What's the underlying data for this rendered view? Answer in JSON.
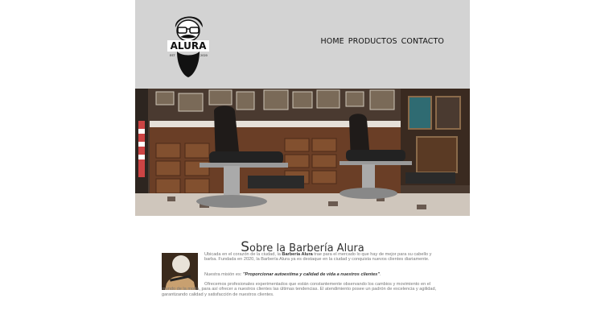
{
  "header": {
    "logo_text": "ALURA",
    "logo_est": "EST",
    "logo_year": "2020",
    "nav": [
      "HOME",
      "PRODUCTOS",
      "CONTACTO"
    ]
  },
  "about": {
    "title_first": "S",
    "title_rest": "obre la Barbería Alura",
    "p1_a": "Ubicada en el corazón de la ciudad, la ",
    "p1_brand": "Barbería Alura",
    "p1_b": " trae para el mercado lo que hay de mejor para su cabello y barba. Fundada en 2020, la Barbería Alura ya es destaque en la ciudad y conquista nuevos clientes diariamente.",
    "p2_a": "Nuestra misión es: ",
    "p2_quote": "\"Proporcionar autoestima y calidad de vida a nuestros clientes\"",
    "p2_b": ".",
    "p3": "Ofrecemos profesionales experimentados que están constantemente observando los cambios y movimiento en el mundo de la moda, para así ofrecer a nuestros clientes las últimas tendencias. El atendimiento posee un padrón de excelencia y agilidad, garantizando calidad y satisfacción de nuestros clientes."
  }
}
